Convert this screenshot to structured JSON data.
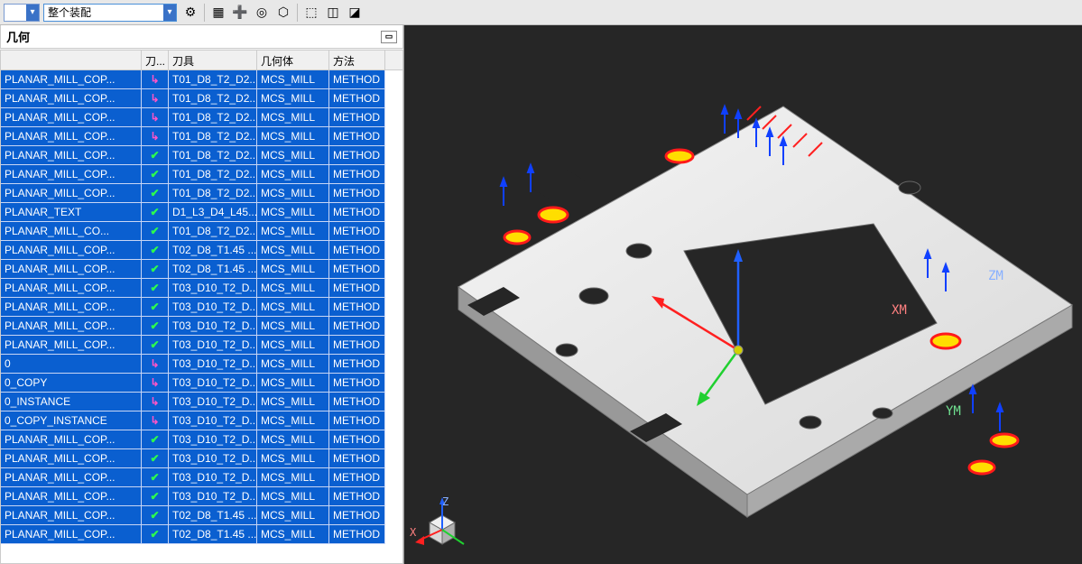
{
  "toolbar": {
    "assembly_text": "整个装配",
    "icons": [
      "tool-icon",
      "boxplus-icon",
      "plus-icon",
      "target-icon",
      "hex-icon",
      "select-icon",
      "cube-icon",
      "cube2-icon"
    ],
    "glyphs": [
      "⚙",
      "▦",
      "➕",
      "◎",
      "⬡",
      "⬚",
      "◫",
      "◪"
    ]
  },
  "panel": {
    "title": "几何",
    "columns": [
      "",
      "刀...",
      "刀具",
      "几何体",
      "方法"
    ]
  },
  "rows": [
    {
      "name": "PLANAR_MILL_COP...",
      "stat": "arrow",
      "tool": "T01_D8_T2_D2...",
      "geom": "MCS_MILL",
      "method": "METHOD"
    },
    {
      "name": "PLANAR_MILL_COP...",
      "stat": "arrow",
      "tool": "T01_D8_T2_D2...",
      "geom": "MCS_MILL",
      "method": "METHOD"
    },
    {
      "name": "PLANAR_MILL_COP...",
      "stat": "arrow",
      "tool": "T01_D8_T2_D2...",
      "geom": "MCS_MILL",
      "method": "METHOD"
    },
    {
      "name": "PLANAR_MILL_COP...",
      "stat": "arrow",
      "tool": "T01_D8_T2_D2...",
      "geom": "MCS_MILL",
      "method": "METHOD"
    },
    {
      "name": "PLANAR_MILL_COP...",
      "stat": "check",
      "tool": "T01_D8_T2_D2...",
      "geom": "MCS_MILL",
      "method": "METHOD"
    },
    {
      "name": "PLANAR_MILL_COP...",
      "stat": "check",
      "tool": "T01_D8_T2_D2...",
      "geom": "MCS_MILL",
      "method": "METHOD"
    },
    {
      "name": "PLANAR_MILL_COP...",
      "stat": "check",
      "tool": "T01_D8_T2_D2...",
      "geom": "MCS_MILL",
      "method": "METHOD"
    },
    {
      "name": "PLANAR_TEXT",
      "stat": "check",
      "tool": "D1_L3_D4_L45...",
      "geom": "MCS_MILL",
      "method": "METHOD"
    },
    {
      "name": "PLANAR_MILL_CO...",
      "stat": "check",
      "tool": "T01_D8_T2_D2...",
      "geom": "MCS_MILL",
      "method": "METHOD"
    },
    {
      "name": "PLANAR_MILL_COP...",
      "stat": "check",
      "tool": "T02_D8_T1.45 ...",
      "geom": "MCS_MILL",
      "method": "METHOD"
    },
    {
      "name": "PLANAR_MILL_COP...",
      "stat": "check",
      "tool": "T02_D8_T1.45 ...",
      "geom": "MCS_MILL",
      "method": "METHOD"
    },
    {
      "name": "PLANAR_MILL_COP...",
      "stat": "check",
      "tool": "T03_D10_T2_D...",
      "geom": "MCS_MILL",
      "method": "METHOD"
    },
    {
      "name": "PLANAR_MILL_COP...",
      "stat": "check",
      "tool": "T03_D10_T2_D...",
      "geom": "MCS_MILL",
      "method": "METHOD"
    },
    {
      "name": "PLANAR_MILL_COP...",
      "stat": "check",
      "tool": "T03_D10_T2_D...",
      "geom": "MCS_MILL",
      "method": "METHOD"
    },
    {
      "name": "PLANAR_MILL_COP...",
      "stat": "check",
      "tool": "T03_D10_T2_D...",
      "geom": "MCS_MILL",
      "method": "METHOD"
    },
    {
      "name": "0",
      "stat": "arrow",
      "tool": "T03_D10_T2_D...",
      "geom": "MCS_MILL",
      "method": "METHOD"
    },
    {
      "name": "0_COPY",
      "stat": "arrow",
      "tool": "T03_D10_T2_D...",
      "geom": "MCS_MILL",
      "method": "METHOD"
    },
    {
      "name": "0_INSTANCE",
      "stat": "arrow",
      "tool": "T03_D10_T2_D...",
      "geom": "MCS_MILL",
      "method": "METHOD"
    },
    {
      "name": "0_COPY_INSTANCE",
      "stat": "arrow",
      "tool": "T03_D10_T2_D...",
      "geom": "MCS_MILL",
      "method": "METHOD"
    },
    {
      "name": "PLANAR_MILL_COP...",
      "stat": "check",
      "tool": "T03_D10_T2_D...",
      "geom": "MCS_MILL",
      "method": "METHOD"
    },
    {
      "name": "PLANAR_MILL_COP...",
      "stat": "check",
      "tool": "T03_D10_T2_D...",
      "geom": "MCS_MILL",
      "method": "METHOD"
    },
    {
      "name": "PLANAR_MILL_COP...",
      "stat": "check",
      "tool": "T03_D10_T2_D...",
      "geom": "MCS_MILL",
      "method": "METHOD"
    },
    {
      "name": "PLANAR_MILL_COP...",
      "stat": "check",
      "tool": "T03_D10_T2_D...",
      "geom": "MCS_MILL",
      "method": "METHOD"
    },
    {
      "name": "PLANAR_MILL_COP...",
      "stat": "check",
      "tool": "T02_D8_T1.45 ...",
      "geom": "MCS_MILL",
      "method": "METHOD"
    },
    {
      "name": "PLANAR_MILL_COP...",
      "stat": "check",
      "tool": "T02_D8_T1.45 ...",
      "geom": "MCS_MILL",
      "method": "METHOD"
    }
  ],
  "axes": {
    "x": "XM",
    "y": "YM",
    "z": "ZM",
    "cornerX": "X",
    "cornerZ": "Z"
  },
  "colors": {
    "sel": "#0a5fd0",
    "xaxis": "#ff2020",
    "yaxis": "#20d030",
    "zaxis": "#2060ff"
  }
}
